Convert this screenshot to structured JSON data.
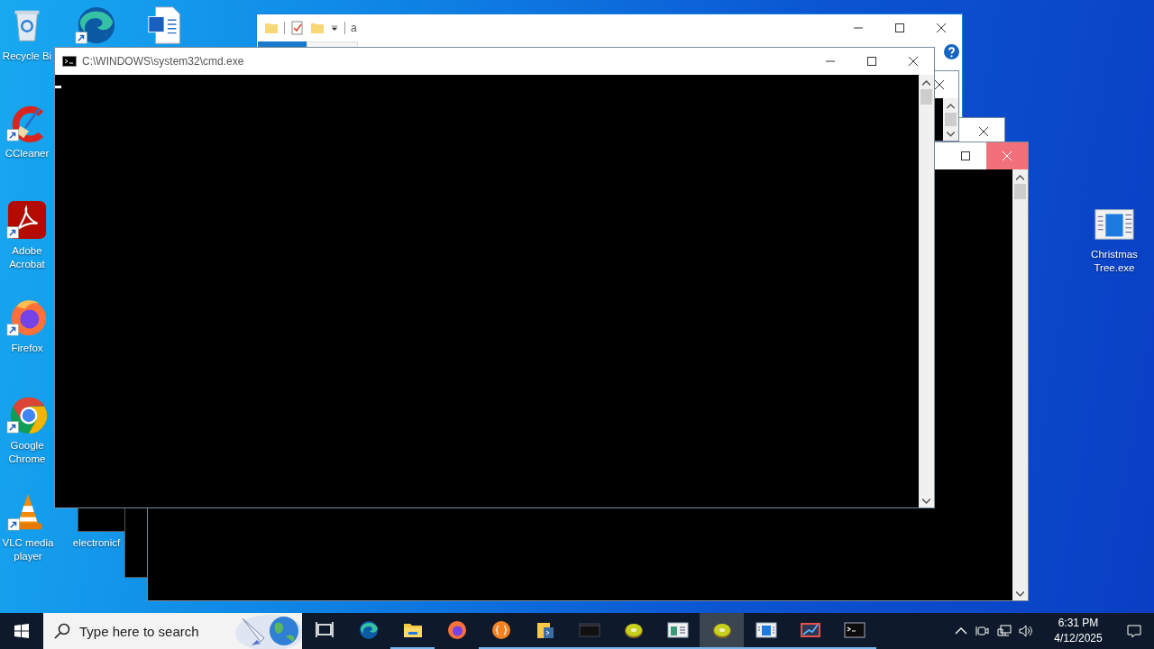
{
  "desktop_icons": [
    {
      "label": "Recycle Bi",
      "kind": "recycle-bin"
    },
    {
      "label": "CCleaner",
      "kind": "ccleaner"
    },
    {
      "label": "Adobe Acrobat",
      "kind": "acrobat"
    },
    {
      "label": "Firefox",
      "kind": "firefox"
    },
    {
      "label": "Google Chrome",
      "kind": "chrome"
    },
    {
      "label": "VLC media player",
      "kind": "vlc"
    },
    {
      "kind": "edge"
    },
    {
      "kind": "word"
    },
    {
      "label": "electronicf",
      "kind": "hidden"
    },
    {
      "label": "Christmas Tree.exe",
      "kind": "app-window"
    }
  ],
  "explorer_window": {
    "title": "a"
  },
  "console_window_back": {
    "close_hovered": true
  },
  "cmd_window": {
    "title": "C:\\WINDOWS\\system32\\cmd.exe"
  },
  "taskbar": {
    "search": {
      "placeholder": "Type here to search"
    },
    "items": [
      {
        "kind": "task-view",
        "running": false,
        "selected": false
      },
      {
        "kind": "edge",
        "running": false,
        "selected": false
      },
      {
        "kind": "explorer",
        "running": true,
        "selected": false
      },
      {
        "kind": "firefox",
        "running": false,
        "selected": false
      },
      {
        "kind": "braces",
        "running": true,
        "selected": false
      },
      {
        "kind": "python",
        "running": true,
        "selected": false
      },
      {
        "kind": "dark-window",
        "running": true,
        "selected": false
      },
      {
        "kind": "kiwi",
        "running": true,
        "selected": false
      },
      {
        "kind": "form-window",
        "running": true,
        "selected": false
      },
      {
        "kind": "kiwi",
        "running": true,
        "selected": true
      },
      {
        "kind": "app-window",
        "running": true,
        "selected": false
      },
      {
        "kind": "chart-window",
        "running": true,
        "selected": false
      },
      {
        "kind": "terminal",
        "running": true,
        "selected": false
      }
    ],
    "clock": {
      "time": "6:31 PM",
      "date": "4/12/2025"
    }
  }
}
